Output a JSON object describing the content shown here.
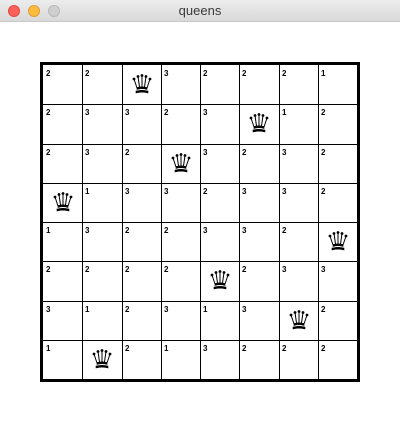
{
  "window": {
    "title": "queens"
  },
  "board": {
    "size": 8,
    "queen_icon": "queen-icon",
    "cells": [
      [
        {
          "v": "2",
          "q": false
        },
        {
          "v": "2",
          "q": false
        },
        {
          "v": "",
          "q": true
        },
        {
          "v": "3",
          "q": false
        },
        {
          "v": "2",
          "q": false
        },
        {
          "v": "2",
          "q": false
        },
        {
          "v": "2",
          "q": false
        },
        {
          "v": "1",
          "q": false
        }
      ],
      [
        {
          "v": "2",
          "q": false
        },
        {
          "v": "3",
          "q": false
        },
        {
          "v": "3",
          "q": false
        },
        {
          "v": "2",
          "q": false
        },
        {
          "v": "3",
          "q": false
        },
        {
          "v": "",
          "q": true
        },
        {
          "v": "1",
          "q": false
        },
        {
          "v": "2",
          "q": false
        }
      ],
      [
        {
          "v": "2",
          "q": false
        },
        {
          "v": "3",
          "q": false
        },
        {
          "v": "2",
          "q": false
        },
        {
          "v": "",
          "q": true
        },
        {
          "v": "3",
          "q": false
        },
        {
          "v": "2",
          "q": false
        },
        {
          "v": "3",
          "q": false
        },
        {
          "v": "2",
          "q": false
        }
      ],
      [
        {
          "v": "",
          "q": true
        },
        {
          "v": "1",
          "q": false
        },
        {
          "v": "3",
          "q": false
        },
        {
          "v": "3",
          "q": false
        },
        {
          "v": "2",
          "q": false
        },
        {
          "v": "3",
          "q": false
        },
        {
          "v": "3",
          "q": false
        },
        {
          "v": "2",
          "q": false
        }
      ],
      [
        {
          "v": "1",
          "q": false
        },
        {
          "v": "3",
          "q": false
        },
        {
          "v": "2",
          "q": false
        },
        {
          "v": "2",
          "q": false
        },
        {
          "v": "3",
          "q": false
        },
        {
          "v": "3",
          "q": false
        },
        {
          "v": "2",
          "q": false
        },
        {
          "v": "",
          "q": true
        }
      ],
      [
        {
          "v": "2",
          "q": false
        },
        {
          "v": "2",
          "q": false
        },
        {
          "v": "2",
          "q": false
        },
        {
          "v": "2",
          "q": false
        },
        {
          "v": "",
          "q": true
        },
        {
          "v": "2",
          "q": false
        },
        {
          "v": "3",
          "q": false
        },
        {
          "v": "3",
          "q": false
        }
      ],
      [
        {
          "v": "3",
          "q": false
        },
        {
          "v": "1",
          "q": false
        },
        {
          "v": "2",
          "q": false
        },
        {
          "v": "3",
          "q": false
        },
        {
          "v": "1",
          "q": false
        },
        {
          "v": "3",
          "q": false
        },
        {
          "v": "",
          "q": true
        },
        {
          "v": "2",
          "q": false
        }
      ],
      [
        {
          "v": "1",
          "q": false
        },
        {
          "v": "",
          "q": true
        },
        {
          "v": "2",
          "q": false
        },
        {
          "v": "1",
          "q": false
        },
        {
          "v": "3",
          "q": false
        },
        {
          "v": "2",
          "q": false
        },
        {
          "v": "2",
          "q": false
        },
        {
          "v": "2",
          "q": false
        }
      ]
    ]
  }
}
